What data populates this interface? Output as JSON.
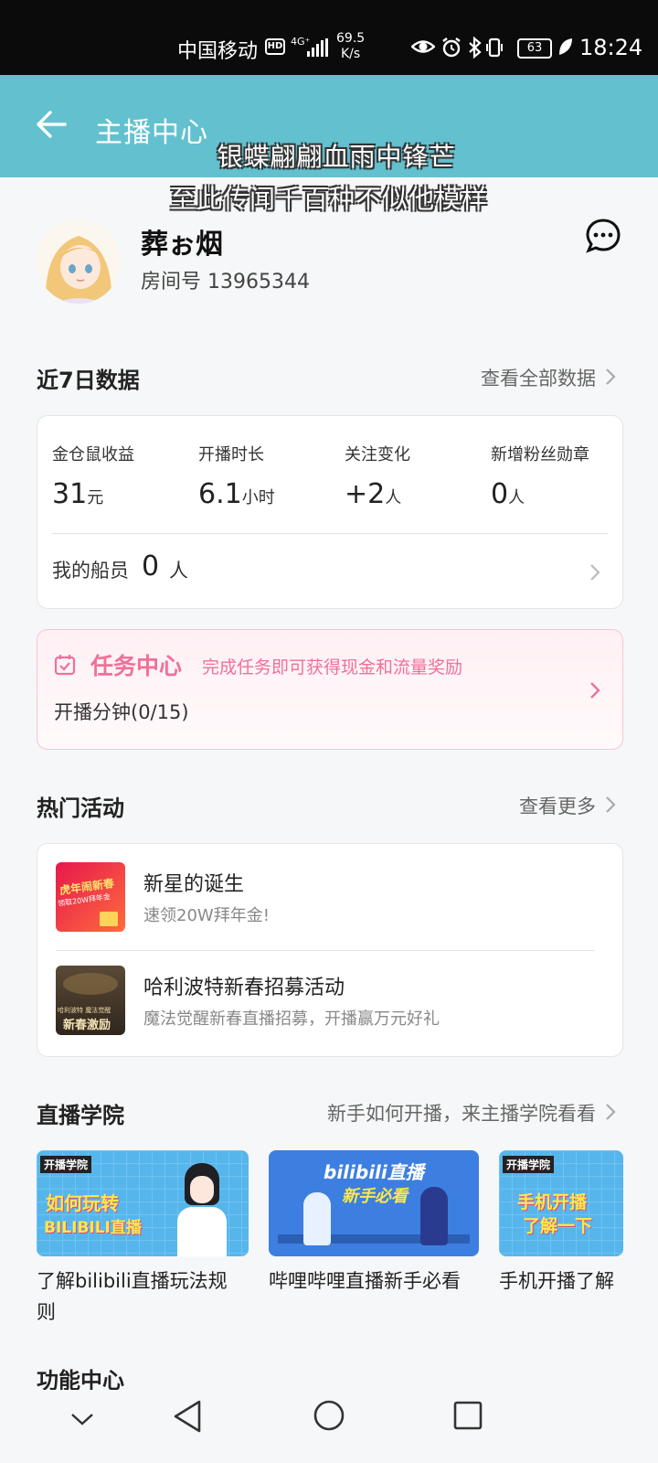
{
  "status_bar": {
    "carrier": "中国移动",
    "hd": "HD",
    "signal": "4G⁺",
    "speed_value": "69.5",
    "speed_unit": "K/s",
    "battery": "63",
    "time": "18:24"
  },
  "header": {
    "title": "主播中心"
  },
  "overlay_lyrics": {
    "line1": "银蝶翩翩血雨中锋芒",
    "line2": "至此传闻千百种不似他模样"
  },
  "profile": {
    "name": "葬ぉ烟",
    "room_label": "房间号 13965344"
  },
  "weekly": {
    "title": "近7日数据",
    "link": "查看全部数据",
    "stats": [
      {
        "label": "金仓鼠收益",
        "value": "31",
        "unit": "元"
      },
      {
        "label": "开播时长",
        "value": "6.1",
        "unit": "小时"
      },
      {
        "label": "关注变化",
        "value": "+2",
        "unit": "人"
      },
      {
        "label": "新增粉丝勋章",
        "value": "0",
        "unit": "人"
      }
    ],
    "crew_label": "我的船员",
    "crew_value": "0",
    "crew_unit": "人"
  },
  "task": {
    "title": "任务中心",
    "subtitle": "完成任务即可获得现金和流量奖励",
    "progress_text": "开播分钟(0/15)"
  },
  "activities": {
    "title": "热门活动",
    "link": "查看更多",
    "items": [
      {
        "title": "新星的诞生",
        "subtitle": "速领20W拜年金!",
        "thumb_text1": "虎年闹新春",
        "thumb_text2": "领取20W拜年金"
      },
      {
        "title": "哈利波特新春招募活动",
        "subtitle": "魔法觉醒新春直播招募，开播赢万元好礼",
        "thumb_text1": "哈利波特 魔法觉醒",
        "thumb_text2": "新春激励"
      }
    ]
  },
  "academy": {
    "title": "直播学院",
    "link": "新手如何开播，来主播学院看看",
    "courses": [
      {
        "caption": "了解bilibili直播玩法规则",
        "caption_line1": "了解bilibili直播玩法规",
        "caption_line2": "则",
        "thumb_text1": "开播学院",
        "thumb_text2": "如何玩转",
        "thumb_text3": "BILIBILI直播"
      },
      {
        "caption": "哔哩哔哩直播新手必看",
        "thumb_text1": "bilibili直播",
        "thumb_text2": "新手必看"
      },
      {
        "caption": "手机开播了解",
        "thumb_text1": "开播学院",
        "thumb_text2": "手机开播",
        "thumb_text3": "了解一下"
      }
    ]
  },
  "functions": {
    "title": "功能中心"
  },
  "colors": {
    "header_bg": "#63c1cf",
    "task_pink": "#f0709a",
    "status_bg": "#0b0b0b"
  }
}
